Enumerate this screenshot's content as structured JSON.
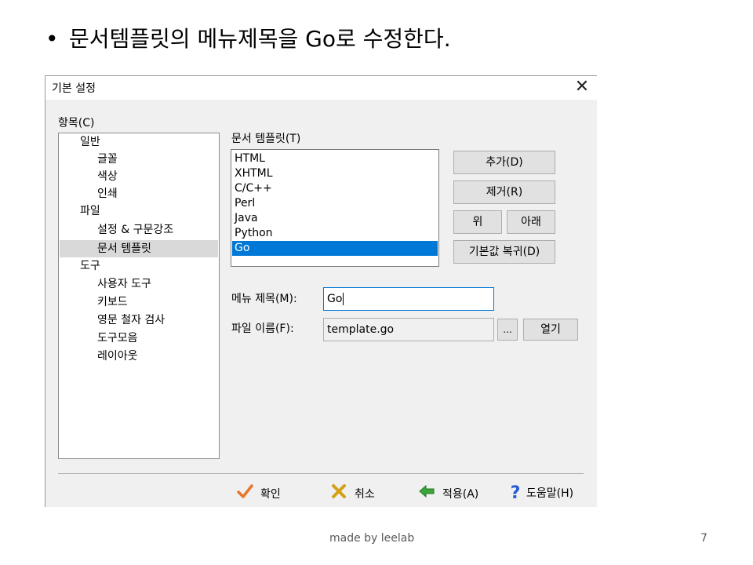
{
  "slide": {
    "bullet_text": "문서템플릿의 메뉴제목을 Go로 수정한다.",
    "footer_text": "made by leelab",
    "page_number": "7"
  },
  "dialog": {
    "title": "기본 설정",
    "close_glyph": "✕",
    "category_label": "항목(C)",
    "tree": [
      {
        "label": "일반",
        "level": 0
      },
      {
        "label": "글꼴",
        "level": 1
      },
      {
        "label": "색상",
        "level": 1
      },
      {
        "label": "인쇄",
        "level": 1
      },
      {
        "label": "파일",
        "level": 0
      },
      {
        "label": "설정 & 구문강조",
        "level": 1
      },
      {
        "label": "문서 템플릿",
        "level": 1,
        "selected": true
      },
      {
        "label": "도구",
        "level": 0
      },
      {
        "label": "사용자 도구",
        "level": 1
      },
      {
        "label": "키보드",
        "level": 1
      },
      {
        "label": "영문 철자 검사",
        "level": 1
      },
      {
        "label": "도구모음",
        "level": 1
      },
      {
        "label": "레이아웃",
        "level": 1
      }
    ],
    "templates_label": "문서 템플릿(T)",
    "templates": [
      "HTML",
      "XHTML",
      "C/C++",
      "Perl",
      "Java",
      "Python",
      "Go"
    ],
    "selected_template": "Go",
    "buttons": {
      "add": "추가(D)",
      "remove": "제거(R)",
      "up": "위",
      "down": "아래",
      "restore": "기본값 복귀(D)",
      "browse": "...",
      "open": "열기"
    },
    "menu_title_label": "메뉴 제목(M):",
    "menu_title_value": "Go",
    "file_name_label": "파일 이름(F):",
    "file_name_value": "template.go",
    "footer": {
      "ok": "확인",
      "cancel": "취소",
      "apply": "적용(A)",
      "help": "도움말(H)"
    },
    "icons": {
      "ok": "check-icon",
      "cancel": "x-icon",
      "apply": "arrow-left-icon",
      "help": "question-icon"
    },
    "colors": {
      "selection": "#0078d7",
      "ok_icon": "#e8752a",
      "cancel_icon": "#d4a017",
      "apply_icon": "#3aa53a",
      "help_icon": "#2a5bd7"
    }
  }
}
